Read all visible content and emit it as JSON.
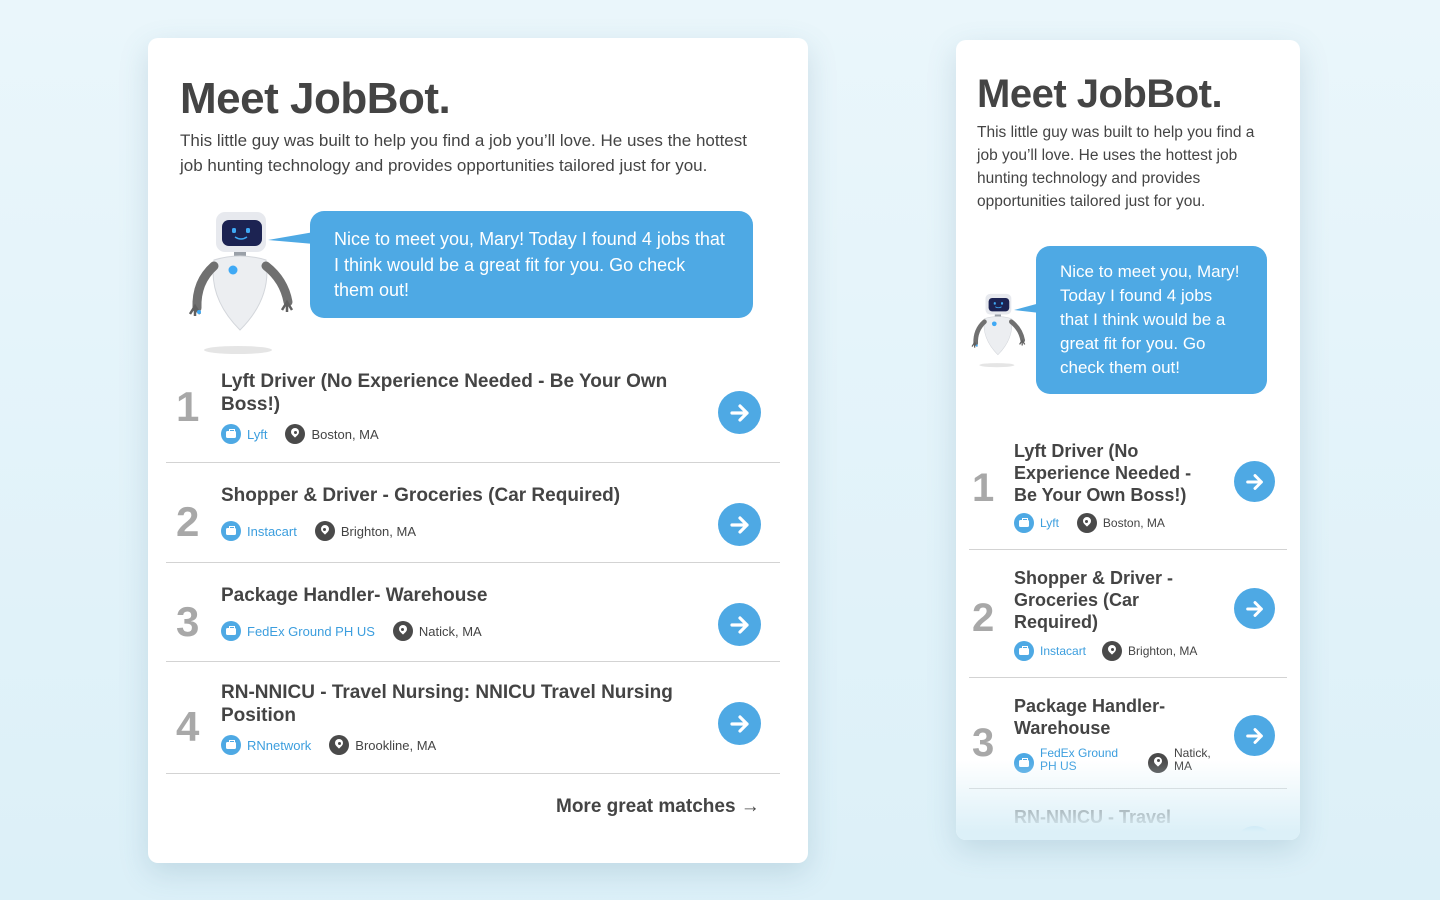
{
  "intro": {
    "title": "Meet JobBot.",
    "body": "This little guy was built to help you find a job you’ll love. He uses the hottest job hunting technology and provides opportunities tailored just for you."
  },
  "bot": {
    "message": "Nice to meet you, Mary! Today I found 4 jobs that I think would be a great fit for you. Go check them out!"
  },
  "jobs": [
    {
      "number": "1",
      "title": "Lyft Driver (No Experience Needed - Be Your Own Boss!)",
      "company": "Lyft",
      "location": "Boston, MA"
    },
    {
      "number": "2",
      "title": "Shopper & Driver - Groceries (Car Required)",
      "company": "Instacart",
      "location": "Brighton, MA"
    },
    {
      "number": "3",
      "title": "Package Handler- Warehouse",
      "company": "FedEx Ground PH US",
      "location": "Natick, MA"
    },
    {
      "number": "4",
      "title": "RN-NNICU - Travel Nursing: NNICU Travel Nursing Position",
      "company": "RNnetwork",
      "location": "Brookline, MA"
    }
  ],
  "more_label": "More great matches →",
  "colors": {
    "accent": "#4ea9e4",
    "link": "#3c9ede",
    "text": "#444444",
    "number": "#a8a8a8",
    "background": "#dcf0f8"
  },
  "icons": {
    "company": "briefcase-icon",
    "location": "map-pin-icon",
    "action": "arrow-right-icon"
  }
}
